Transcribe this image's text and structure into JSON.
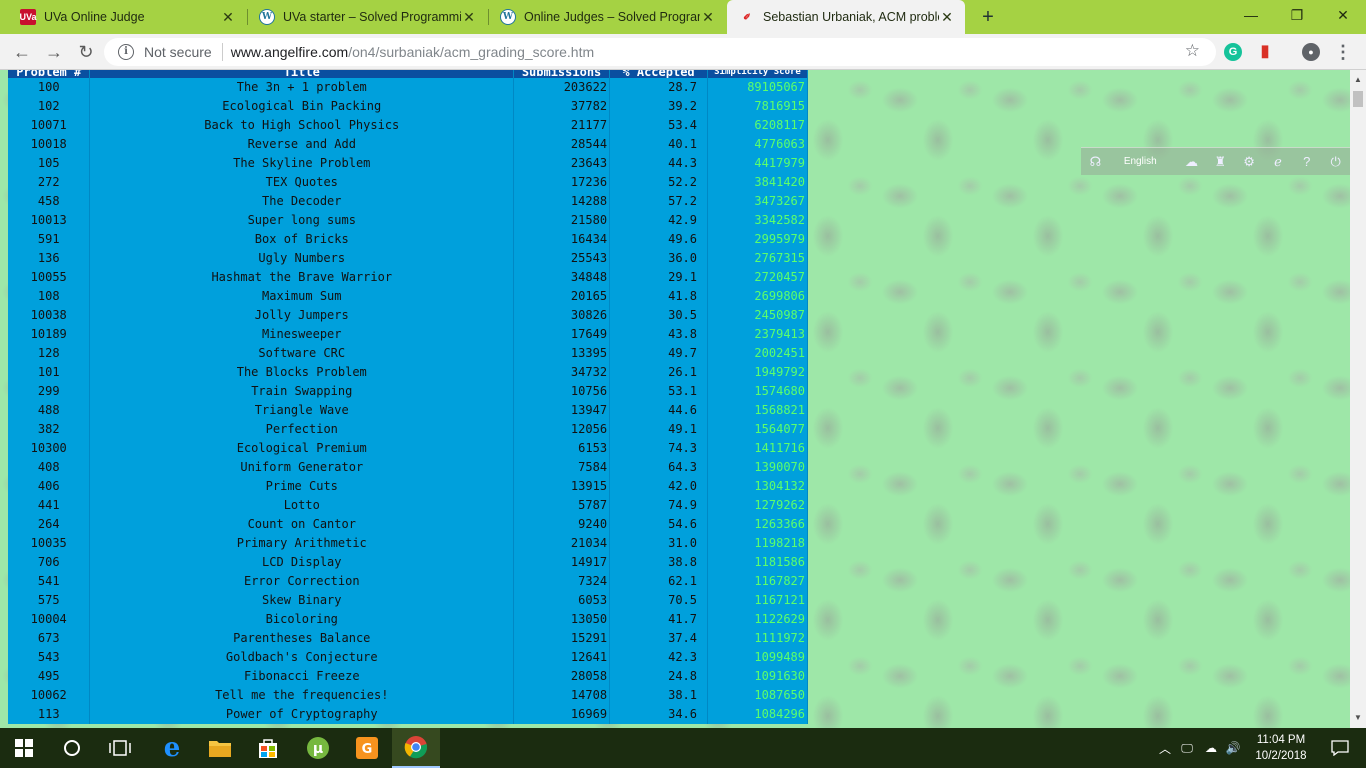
{
  "browser": {
    "tabs": [
      {
        "favicon": "UVa",
        "title": "UVa Online Judge",
        "active": false
      },
      {
        "favicon": "W",
        "title": "UVa starter – Solved Programming",
        "active": false
      },
      {
        "favicon": "W",
        "title": "Online Judges – Solved Program",
        "active": false
      },
      {
        "favicon": "✐",
        "title": "Sebastian Urbaniak, ACM problem",
        "active": true
      }
    ],
    "new_tab": "+",
    "window_controls": {
      "minimize": "—",
      "maximize": "❐",
      "close": "✕"
    },
    "toolbar": {
      "back": "←",
      "forward": "→",
      "reload": "↻",
      "security_label": "Not secure",
      "url_host": "www.angelfire.com",
      "url_path": "/on4/surbaniak/acm_grading_score.htm",
      "bookmark": "☆",
      "extensions": [
        {
          "name": "grammarly",
          "glyph": "G",
          "color": "#15c39a"
        },
        {
          "name": "book",
          "glyph": "▮",
          "color": "#d93025"
        },
        {
          "name": "account",
          "glyph": "●",
          "color": "#5f6368"
        },
        {
          "name": "menu",
          "glyph": "⋮",
          "color": "#5f6368"
        }
      ]
    }
  },
  "table": {
    "headers": [
      "Problem #",
      "Title",
      "Submissions",
      "% Accepted",
      "Simplicity Score"
    ],
    "rows": [
      [
        "100",
        "The 3n + 1 problem",
        "203622",
        "28.7",
        "89105067"
      ],
      [
        "102",
        "Ecological Bin Packing",
        "37782",
        "39.2",
        "7816915"
      ],
      [
        "10071",
        "Back to High School Physics",
        "21177",
        "53.4",
        "6208117"
      ],
      [
        "10018",
        "Reverse and Add",
        "28544",
        "40.1",
        "4776063"
      ],
      [
        "105",
        "The Skyline Problem",
        "23643",
        "44.3",
        "4417979"
      ],
      [
        "272",
        "TEX Quotes",
        "17236",
        "52.2",
        "3841420"
      ],
      [
        "458",
        "The Decoder",
        "14288",
        "57.2",
        "3473267"
      ],
      [
        "10013",
        "Super long sums",
        "21580",
        "42.9",
        "3342582"
      ],
      [
        "591",
        "Box of Bricks",
        "16434",
        "49.6",
        "2995979"
      ],
      [
        "136",
        "Ugly Numbers",
        "25543",
        "36.0",
        "2767315"
      ],
      [
        "10055",
        "Hashmat the Brave Warrior",
        "34848",
        "29.1",
        "2720457"
      ],
      [
        "108",
        "Maximum Sum",
        "20165",
        "41.8",
        "2699806"
      ],
      [
        "10038",
        "Jolly Jumpers",
        "30826",
        "30.5",
        "2450987"
      ],
      [
        "10189",
        "Minesweeper",
        "17649",
        "43.8",
        "2379413"
      ],
      [
        "128",
        "Software CRC",
        "13395",
        "49.7",
        "2002451"
      ],
      [
        "101",
        "The Blocks Problem",
        "34732",
        "26.1",
        "1949792"
      ],
      [
        "299",
        "Train Swapping",
        "10756",
        "53.1",
        "1574680"
      ],
      [
        "488",
        "Triangle Wave",
        "13947",
        "44.6",
        "1568821"
      ],
      [
        "382",
        "Perfection",
        "12056",
        "49.1",
        "1564077"
      ],
      [
        "10300",
        "Ecological Premium",
        "6153",
        "74.3",
        "1411716"
      ],
      [
        "408",
        "Uniform Generator",
        "7584",
        "64.3",
        "1390070"
      ],
      [
        "406",
        "Prime Cuts",
        "13915",
        "42.0",
        "1304132"
      ],
      [
        "441",
        "Lotto",
        "5787",
        "74.9",
        "1279262"
      ],
      [
        "264",
        "Count on Cantor",
        "9240",
        "54.6",
        "1263366"
      ],
      [
        "10035",
        "Primary Arithmetic",
        "21034",
        "31.0",
        "1198218"
      ],
      [
        "706",
        "LCD Display",
        "14917",
        "38.8",
        "1181586"
      ],
      [
        "541",
        "Error Correction",
        "7324",
        "62.1",
        "1167827"
      ],
      [
        "575",
        "Skew Binary",
        "6053",
        "70.5",
        "1167121"
      ],
      [
        "10004",
        "Bicoloring",
        "13050",
        "41.7",
        "1122629"
      ],
      [
        "673",
        "Parentheses Balance",
        "15291",
        "37.4",
        "1111972"
      ],
      [
        "543",
        "Goldbach's Conjecture",
        "12641",
        "42.3",
        "1099489"
      ],
      [
        "495",
        "Fibonacci Freeze",
        "28058",
        "24.8",
        "1091630"
      ],
      [
        "10062",
        "Tell me the frequencies!",
        "14708",
        "38.1",
        "1087650"
      ],
      [
        "113",
        "Power of Cryptography",
        "16969",
        "34.6",
        "1084296"
      ]
    ]
  },
  "widget": {
    "language": "English"
  },
  "taskbar": {
    "time": "11:04 PM",
    "date": "10/2/2018"
  }
}
